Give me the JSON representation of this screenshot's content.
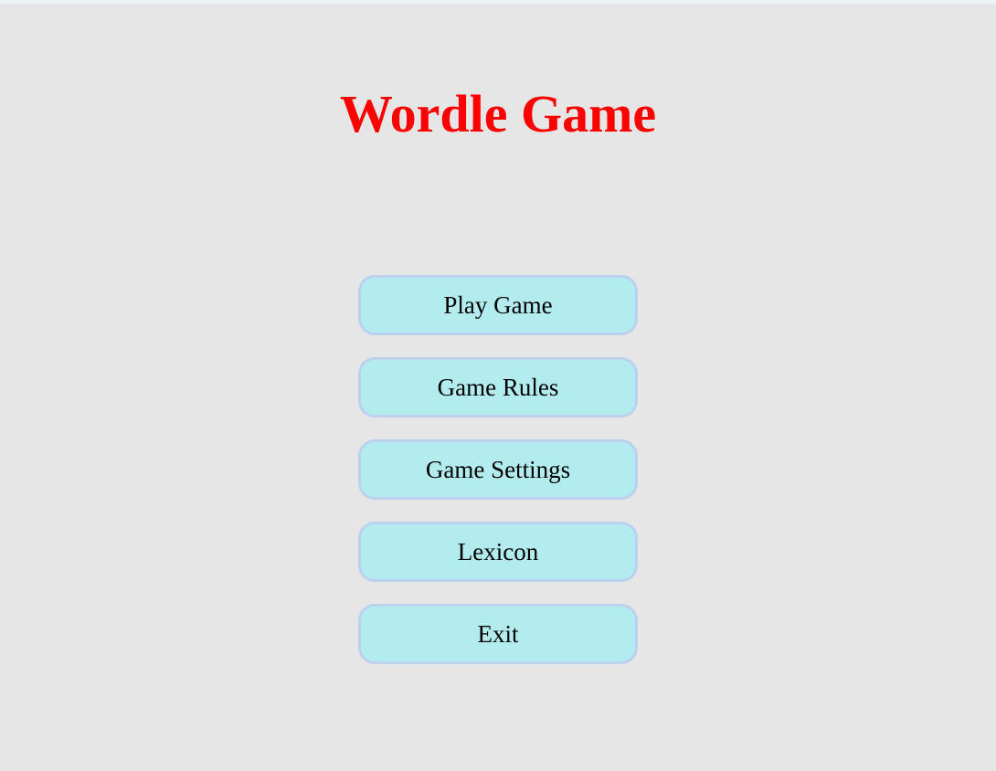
{
  "title": "Wordle Game",
  "colors": {
    "title": "#ff0000",
    "button_background": "#b2ecee",
    "button_border": "#bcd1ee",
    "page_background": "#e6e6e6"
  },
  "menu": {
    "buttons": [
      {
        "label": "Play Game"
      },
      {
        "label": "Game Rules"
      },
      {
        "label": "Game Settings"
      },
      {
        "label": "Lexicon"
      },
      {
        "label": "Exit"
      }
    ]
  }
}
